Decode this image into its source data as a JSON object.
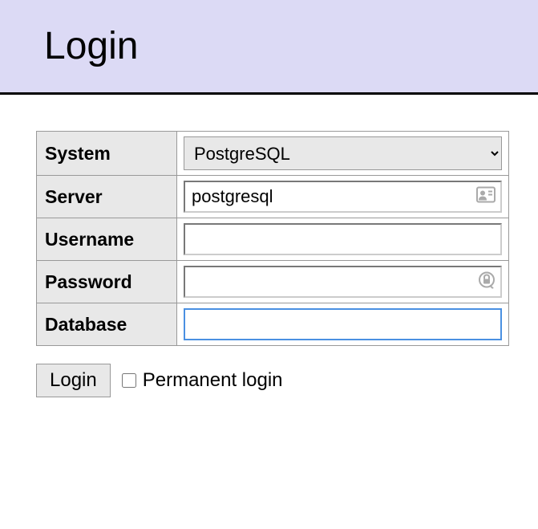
{
  "header": {
    "title": "Login"
  },
  "form": {
    "system": {
      "label": "System",
      "selected": "PostgreSQL",
      "options": [
        "PostgreSQL"
      ]
    },
    "server": {
      "label": "Server",
      "value": "postgresql"
    },
    "username": {
      "label": "Username",
      "value": ""
    },
    "password": {
      "label": "Password",
      "value": ""
    },
    "database": {
      "label": "Database",
      "value": ""
    }
  },
  "actions": {
    "login_button": "Login",
    "permanent_label": "Permanent login",
    "permanent_checked": false
  }
}
